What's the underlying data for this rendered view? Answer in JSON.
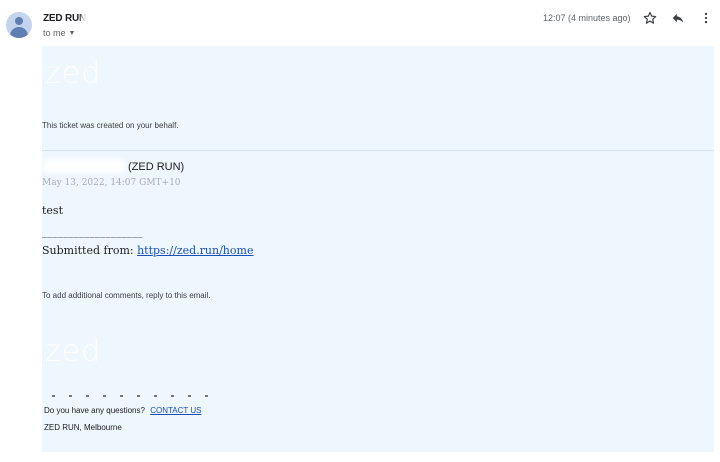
{
  "header": {
    "sender_name": "ZED RUN",
    "to_label": "to me",
    "timestamp": "12:07 (4 minutes ago)",
    "actions": [
      "star-icon",
      "reply-icon",
      "more-vert-icon"
    ]
  },
  "email": {
    "logo_text": "zed",
    "created_note": "This ticket was created on your behalf.",
    "requester_suffix": "(ZED RUN)",
    "request_date": "May 13, 2022, 14:07 GMT+10",
    "message": "test",
    "separator": "___________________",
    "submitted_label": "Submitted from:",
    "submitted_link": "https://zed.run/home",
    "reply_note": "To add additional comments, reply to this email.",
    "footer_logo_text": "zed",
    "questions_label": "Do you have any questions?",
    "contact_link": "CONTACT US",
    "location": "ZED RUN, Melbourne"
  },
  "colors": {
    "body_bg": "#eef6fe",
    "link": "#1a4fb8",
    "avatar_bg": "#c3d4ec",
    "avatar_fg": "#5f7fb3"
  }
}
